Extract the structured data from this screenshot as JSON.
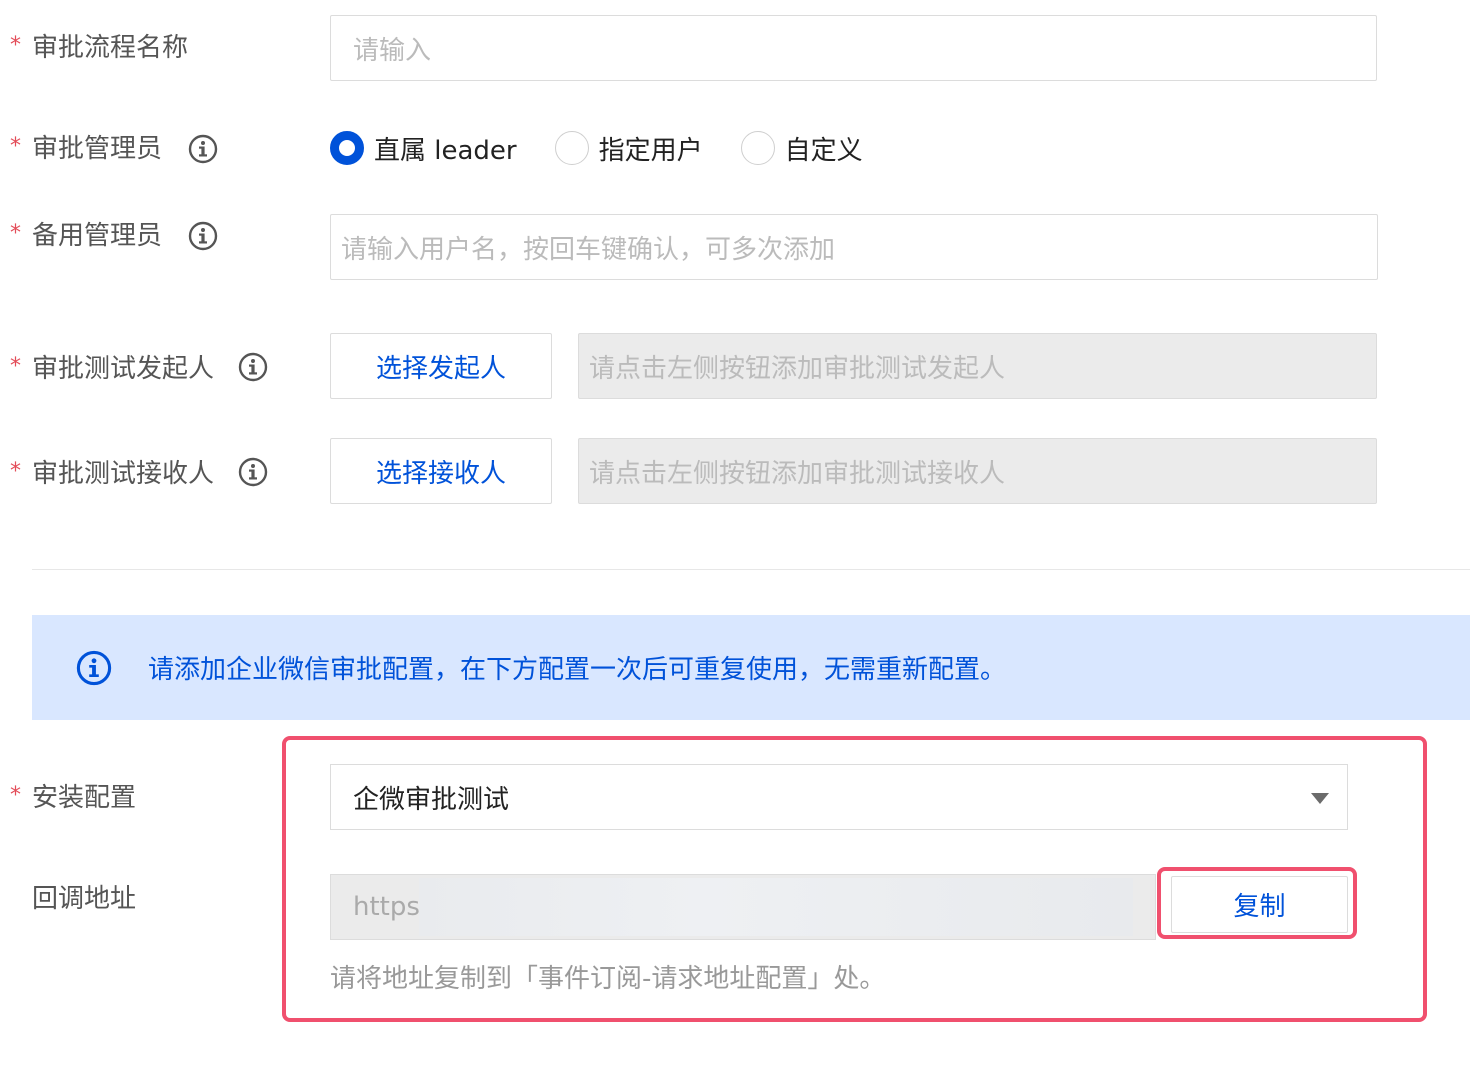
{
  "form": {
    "flow_name": {
      "label": "审批流程名称",
      "placeholder": "请输入"
    },
    "admin": {
      "label": "审批管理员",
      "options": [
        "直属 leader",
        "指定用户",
        "自定义"
      ],
      "selected": "直属 leader"
    },
    "backup_admin": {
      "label": "备用管理员",
      "placeholder": "请输入用户名，按回车键确认，可多次添加"
    },
    "test_initiator": {
      "label": "审批测试发起人",
      "button": "选择发起人",
      "placeholder": "请点击左侧按钮添加审批测试发起人"
    },
    "test_receiver": {
      "label": "审批测试接收人",
      "button": "选择接收人",
      "placeholder": "请点击左侧按钮添加审批测试接收人"
    }
  },
  "notice": {
    "text": "请添加企业微信审批配置，在下方配置一次后可重复使用，无需重新配置。"
  },
  "install": {
    "label": "安装配置",
    "selected": "企微审批测试"
  },
  "callback": {
    "label": "回调地址",
    "value": "https:",
    "copy_button": "复制",
    "hint": "请将地址复制到「事件订阅-请求地址配置」处。"
  },
  "colors": {
    "accent": "#0052d9",
    "required": "#e34d59",
    "highlight": "#f0506e",
    "notice_bg": "#d9e7ff"
  },
  "icons": {
    "info": "info-circle-icon",
    "select": "caret-down-icon"
  }
}
